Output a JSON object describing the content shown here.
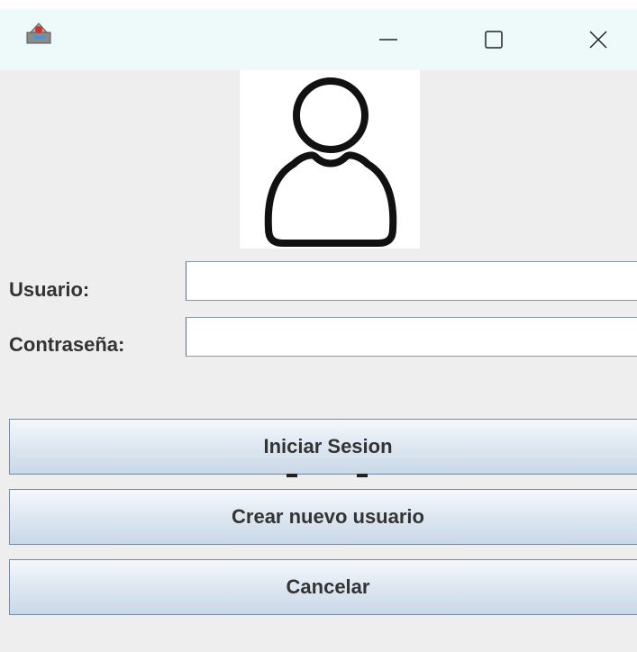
{
  "window": {
    "icons": {
      "app": "java-app-icon",
      "minimize": "minimize-icon",
      "maximize": "maximize-icon",
      "close": "close-icon"
    }
  },
  "avatar": {
    "icon": "user-icon"
  },
  "form": {
    "username_label": "Usuario:",
    "username_value": "",
    "password_label": "Contraseña:",
    "password_value": ""
  },
  "buttons": {
    "login_label": "Iniciar Sesion",
    "create_label": "Crear nuevo usuario",
    "cancel_label": "Cancelar"
  },
  "colors": {
    "background": "#eeeeee",
    "titlebar": "#eef9f9",
    "button_gradient_top": "#f4f8fc",
    "button_gradient_bottom": "#c9d8e7",
    "button_border": "#7a8a9e",
    "text": "#333333"
  }
}
